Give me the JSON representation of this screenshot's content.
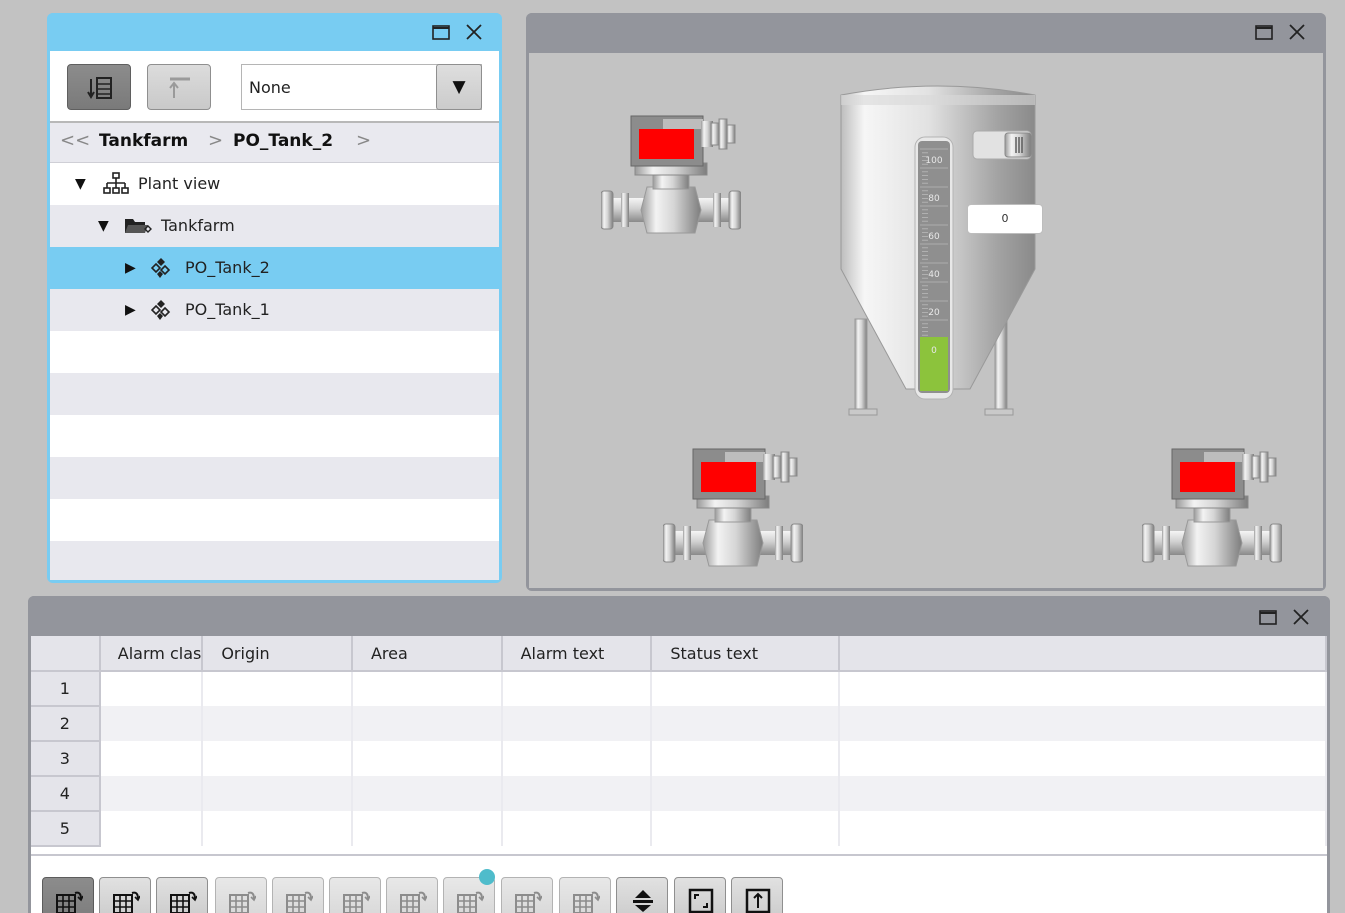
{
  "tree_panel": {
    "toolbar": {
      "filter_select_value": "None"
    },
    "breadcrumb": {
      "back_symbol": "<<",
      "items": [
        "Tankfarm",
        "PO_Tank_2"
      ],
      "sep": ">"
    },
    "tree": [
      {
        "label": "Plant view",
        "icon": "hierarchy-icon",
        "expanded": true
      },
      {
        "label": "Tankfarm",
        "icon": "folder-icon",
        "expanded": true
      },
      {
        "label": "PO_Tank_2",
        "icon": "object-icon",
        "expanded": false,
        "selected": true
      },
      {
        "label": "PO_Tank_1",
        "icon": "object-icon",
        "expanded": false
      }
    ]
  },
  "process_panel": {
    "tank": {
      "scale_labels": [
        "100",
        "80",
        "60",
        "40",
        "20",
        "0"
      ],
      "value": "0",
      "level_percent": 0
    },
    "valves": [
      {
        "state_color": "#ff0000"
      },
      {
        "state_color": "#ff0000"
      },
      {
        "state_color": "#ff0000"
      }
    ]
  },
  "alarm_panel": {
    "columns": [
      "Alarm clas",
      "Origin",
      "Area",
      "Alarm text",
      "Status text"
    ],
    "rows": [
      "1",
      "2",
      "3",
      "4",
      "5"
    ],
    "toolbar_buttons": [
      "single-acknowledge-icon",
      "archive-export-icon",
      "archive-import-icon",
      "move-first-icon",
      "move-up-icon",
      "move-down-icon",
      "move-last-icon",
      "edit-filter-icon",
      "edit-icon",
      "reset-icon",
      "autoscroll-icon",
      "fit-view-icon",
      "toggle-view-icon"
    ]
  },
  "colors": {
    "accent": "#78ccf2",
    "title_gray": "#93959c",
    "alarm_red": "#ff0000",
    "level_green": "#8cc33c"
  }
}
